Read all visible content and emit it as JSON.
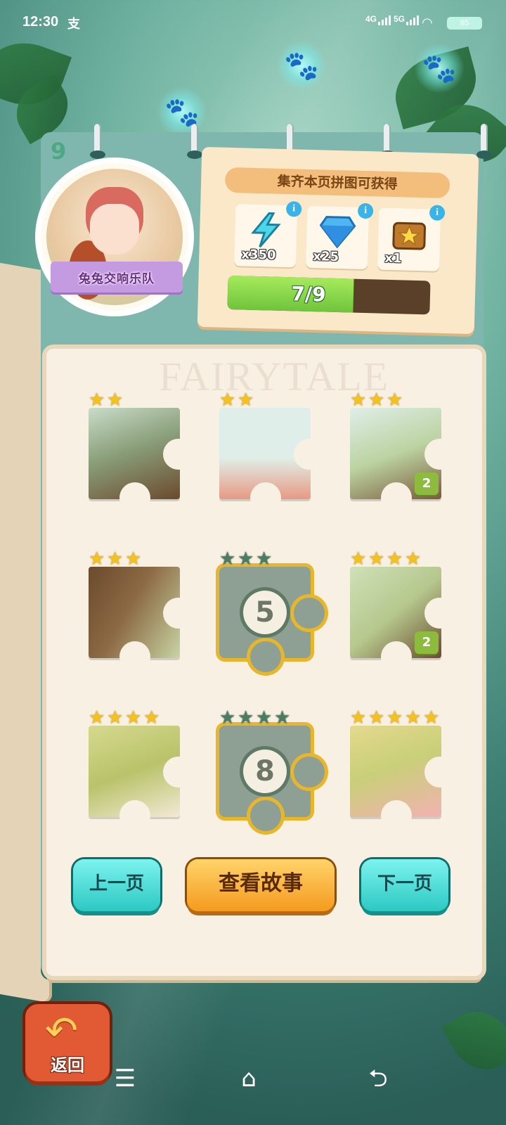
{
  "status_bar": {
    "time": "12:30",
    "app_badge": "支",
    "network1": "4G",
    "network2": "5G",
    "battery": "85"
  },
  "chapter": {
    "number": "9",
    "title": "兔兔交响乐队"
  },
  "reward_panel": {
    "title": "集齐本页拼图可获得",
    "items": [
      {
        "icon": "lightning-icon",
        "quantity": "x350",
        "info": "i"
      },
      {
        "icon": "diamond-icon",
        "quantity": "x25",
        "info": "i"
      },
      {
        "icon": "treasure-chest-icon",
        "quantity": "x1",
        "info": "i"
      }
    ],
    "progress": {
      "text": "7/9",
      "value": 7,
      "max": 9
    }
  },
  "page": {
    "watermark": "FAIRYTALE"
  },
  "puzzle_pieces": [
    {
      "stars": 2,
      "max_stars": 2,
      "locked": false,
      "count": ""
    },
    {
      "stars": 2,
      "max_stars": 2,
      "locked": false,
      "count": ""
    },
    {
      "stars": 3,
      "max_stars": 3,
      "locked": false,
      "count": "2"
    },
    {
      "stars": 3,
      "max_stars": 3,
      "locked": false,
      "count": ""
    },
    {
      "stars": 0,
      "max_stars": 3,
      "locked": true,
      "number": "5"
    },
    {
      "stars": 4,
      "max_stars": 4,
      "locked": false,
      "count": "2"
    },
    {
      "stars": 4,
      "max_stars": 4,
      "locked": false,
      "count": ""
    },
    {
      "stars": 0,
      "max_stars": 4,
      "locked": true,
      "number": "8"
    },
    {
      "stars": 5,
      "max_stars": 5,
      "locked": false,
      "count": ""
    }
  ],
  "buttons": {
    "prev": "上一页",
    "story": "查看故事",
    "next": "下一页",
    "back": "返回"
  },
  "navbar": {
    "menu": "☰",
    "home": "⌂",
    "back": "⮌"
  },
  "colors": {
    "star_gold": "#f5c21c",
    "star_locked": "#4b7c63",
    "lock_border": "#e8b62a",
    "progress_fill": "#6fc43b"
  }
}
